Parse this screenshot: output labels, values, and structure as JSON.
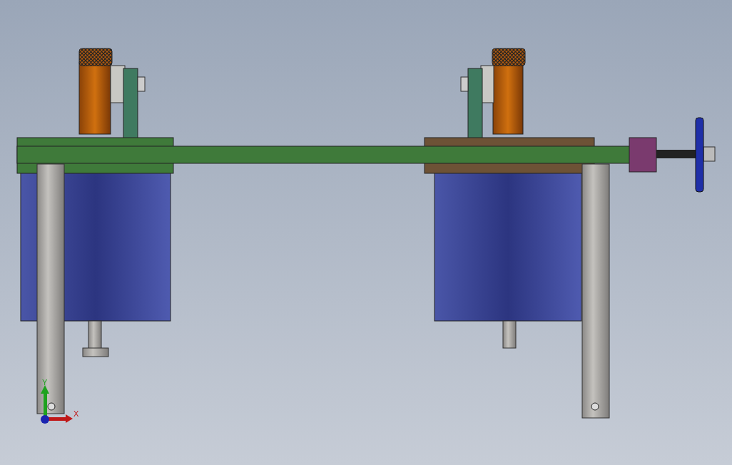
{
  "viewport": {
    "triad": {
      "axes": [
        {
          "kind": "y",
          "label": "Y",
          "color": "#1fa21f"
        },
        {
          "kind": "x",
          "label": "X",
          "color": "#c01818"
        }
      ]
    }
  }
}
